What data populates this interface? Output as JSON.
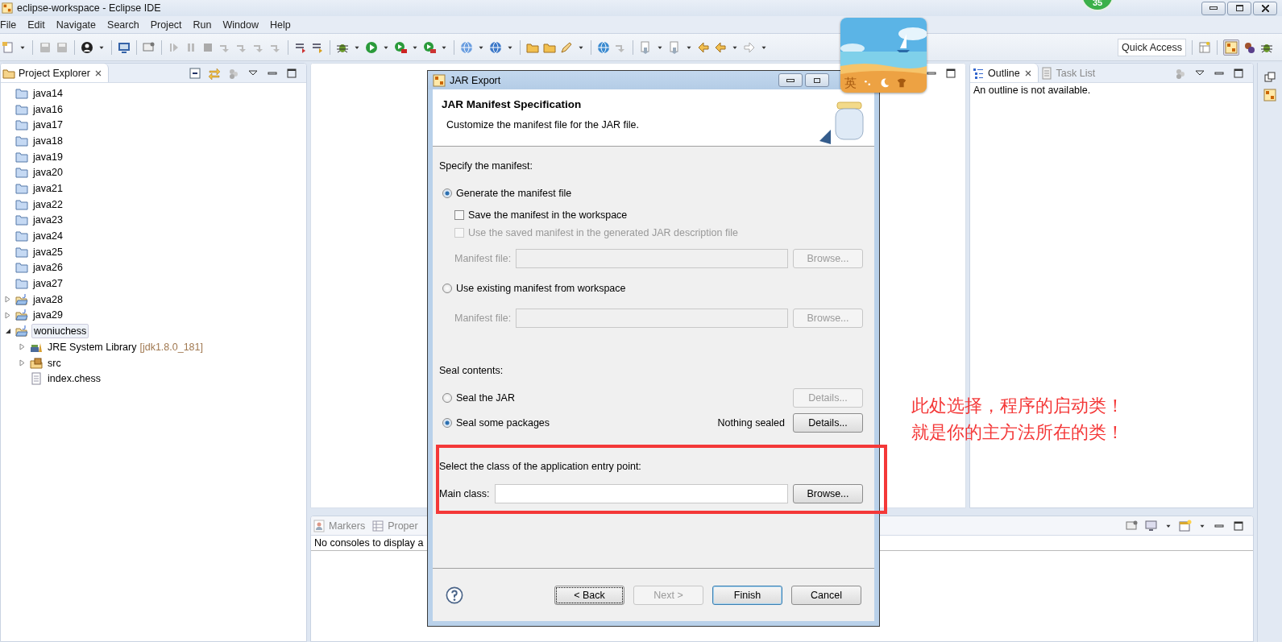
{
  "window": {
    "title": "eclipse-workspace - Eclipse IDE"
  },
  "menu": [
    "File",
    "Edit",
    "Navigate",
    "Search",
    "Project",
    "Run",
    "Window",
    "Help"
  ],
  "toolbar": {
    "quick_access": "Quick Access"
  },
  "floating_badge": {
    "count": "35"
  },
  "ime_widget": {
    "mode": "英"
  },
  "project_explorer": {
    "title": "Project Explorer",
    "items": [
      {
        "label": "java14",
        "kind": "project",
        "open": false,
        "selected": false
      },
      {
        "label": "java16",
        "kind": "project",
        "open": false,
        "selected": false
      },
      {
        "label": "java17",
        "kind": "project",
        "open": false,
        "selected": false
      },
      {
        "label": "java18",
        "kind": "project",
        "open": false,
        "selected": false
      },
      {
        "label": "java19",
        "kind": "project",
        "open": false,
        "selected": false
      },
      {
        "label": "java20",
        "kind": "project",
        "open": false,
        "selected": false
      },
      {
        "label": "java21",
        "kind": "project",
        "open": false,
        "selected": false
      },
      {
        "label": "java22",
        "kind": "project",
        "open": false,
        "selected": false
      },
      {
        "label": "java23",
        "kind": "project",
        "open": false,
        "selected": false
      },
      {
        "label": "java24",
        "kind": "project",
        "open": false,
        "selected": false
      },
      {
        "label": "java25",
        "kind": "project",
        "open": false,
        "selected": false
      },
      {
        "label": "java26",
        "kind": "project",
        "open": false,
        "selected": false
      },
      {
        "label": "java27",
        "kind": "project",
        "open": false,
        "selected": false
      },
      {
        "label": "java28",
        "kind": "project",
        "open": true,
        "expanded": false,
        "selected": false
      },
      {
        "label": "java29",
        "kind": "project",
        "open": true,
        "expanded": false,
        "selected": false
      },
      {
        "label": "woniuchess",
        "kind": "project",
        "open": true,
        "expanded": true,
        "selected": true,
        "children": [
          {
            "label": "JRE System Library",
            "decoration": "[jdk1.8.0_181]",
            "kind": "library",
            "expanded": false,
            "selected": false
          },
          {
            "label": "src",
            "kind": "source-folder",
            "expanded": false,
            "selected": false
          },
          {
            "label": "index.chess",
            "kind": "file",
            "selected": false
          }
        ]
      }
    ]
  },
  "outline": {
    "tabs": [
      {
        "label": "Outline",
        "selected": true
      },
      {
        "label": "Task List",
        "selected": false
      }
    ],
    "message": "An outline is not available."
  },
  "bottom_panel": {
    "tabs": [
      {
        "label": "Markers",
        "selected": false
      },
      {
        "label": "Proper",
        "selected": false
      }
    ],
    "message": "No consoles to display a"
  },
  "dialog": {
    "title": "JAR Export",
    "heading": "JAR Manifest Specification",
    "description": "Customize the manifest file for the JAR file.",
    "rows": [
      {
        "kind": "label",
        "text": "Specify the manifest:"
      },
      {
        "kind": "radio",
        "text": "Generate the manifest file",
        "selected": true
      },
      {
        "kind": "checkbox",
        "text": "Save the manifest in the workspace",
        "checked": false,
        "disabled": false
      },
      {
        "kind": "checkbox",
        "text": "Use the saved manifest in the generated JAR description file",
        "checked": false,
        "disabled": true
      },
      {
        "kind": "field",
        "text": "Manifest file:",
        "button": "Browse...",
        "disabled": true
      },
      {
        "kind": "radio",
        "text": "Use existing manifest from workspace",
        "selected": false
      },
      {
        "kind": "field",
        "text": "Manifest file:",
        "button": "Browse...",
        "disabled": true
      },
      {
        "kind": "label",
        "text": "Seal contents:"
      },
      {
        "kind": "radio",
        "text": "Seal the JAR",
        "selected": false,
        "button": "Details...",
        "disabled": true
      },
      {
        "kind": "radio",
        "text": "Seal some packages",
        "selected": true,
        "note": "Nothing sealed",
        "button": "Details...",
        "disabled": false
      },
      {
        "kind": "label",
        "text": "Select the class of the application entry point:"
      },
      {
        "kind": "field",
        "text": "Main class:",
        "button": "Browse...",
        "disabled": false
      }
    ],
    "buttons": [
      {
        "label": "< Back",
        "disabled": false,
        "default": false,
        "focused": true
      },
      {
        "label": "Next >",
        "disabled": true,
        "default": false,
        "focused": false
      },
      {
        "label": "Finish",
        "disabled": false,
        "default": true,
        "focused": false
      },
      {
        "label": "Cancel",
        "disabled": false,
        "default": false,
        "focused": false
      }
    ]
  },
  "annotation": {
    "lines": [
      "此处选择，程序的启动类！",
      "就是你的主方法所在的类！"
    ]
  }
}
